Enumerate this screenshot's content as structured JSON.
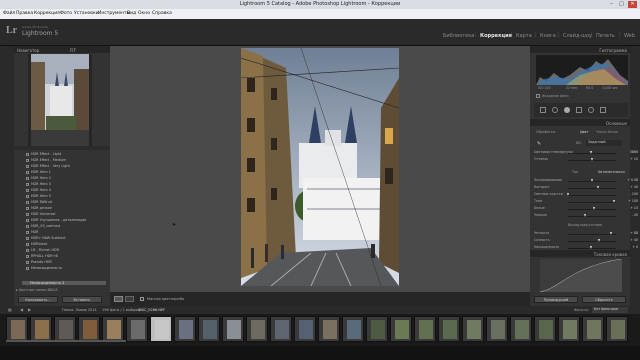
{
  "window": {
    "title": "Lightroom 5 Catalog - Adobe Photoshop Lightroom - Коррекции",
    "minimize": "–",
    "maximize": "□",
    "close": "✕"
  },
  "menu": [
    "Файл",
    "Правка",
    "Коррекция",
    "Фото",
    "Установки",
    "Инструменты",
    "Вид",
    "Окно",
    "Справка"
  ],
  "branding": {
    "logo": "Lr",
    "line1": "Adobe Photoshop",
    "line2": "Lightroom 5"
  },
  "modules": {
    "items": [
      "Библиотека",
      "Коррекция",
      "Карта",
      "Книга",
      "Слайд-шоу",
      "Печать",
      "Web"
    ],
    "active_index": 1
  },
  "left": {
    "navigator_title": "Навигатор",
    "navigator_zoom": "FIT",
    "presets": [
      "HDR Effect - Light",
      "HDR Effect - Medium",
      "HDR Effect - Very Light",
      "HDR Hero 1",
      "HDR Hero 2",
      "HDR Hero 3",
      "HDR Hero 4",
      "HDR Hero 5",
      "HDR RAW ok",
      "HDR резкое",
      "HDR Universal",
      "HDR Улучшение - детализация",
      "HDR_03_contrast",
      "HDR",
      "HDR+ RAW Subtract",
      "HDRblack",
      "LR - Filmish HDR",
      "RPHALL HDR+B",
      "Pseudo HDR",
      "Ненасыщенность"
    ],
    "selected_preset": "Ненасыщенность 2",
    "group": "Цветные линии BW2A",
    "copy_button": "Копировать...",
    "paste_button": "Вставить"
  },
  "toolbar": {
    "softproof": "Мягкая цветопроба"
  },
  "right": {
    "histogram_title": "Гистограмма",
    "photo_info": [
      "ISO 100",
      "22 mm",
      "f/5.0",
      "1/100 sec"
    ],
    "original_photo": "Исходное фото",
    "basic_title": "Основные",
    "treatment_label": "Обработка:",
    "color_option": "Цвет",
    "bw_option": "Черно-белое",
    "wb_label": "ББ:",
    "wb_value": "Заданный",
    "tone_label": "Тон",
    "auto_label": "Автоматически",
    "presence_label": "Выход присутствия",
    "sliders": [
      {
        "label": "Цветовая температура",
        "value": "5866",
        "pos": 0.5
      },
      {
        "label": "Оттенок",
        "value": "+ 10",
        "pos": 0.52
      },
      {
        "label": "Экспонирование",
        "value": "+ 0.06",
        "pos": 0.52
      },
      {
        "label": "Контраст",
        "value": "+ 40",
        "pos": 0.64
      },
      {
        "label": "Светлые участки",
        "value": "- 100",
        "pos": 0.02
      },
      {
        "label": "Тени",
        "value": "+ 100",
        "pos": 0.98
      },
      {
        "label": "Белые",
        "value": "+ 15",
        "pos": 0.56
      },
      {
        "label": "Черные",
        "value": "- 40",
        "pos": 0.36
      },
      {
        "label": "Четкость",
        "value": "+ 88",
        "pos": 0.9
      },
      {
        "label": "Сочность",
        "value": "+ 40",
        "pos": 0.66
      },
      {
        "label": "Насыщенность",
        "value": "+ 0",
        "pos": 0.5
      }
    ],
    "curve_title": "Тоновая кривая",
    "prev_button": "Предыдущий",
    "reset_button": "Сбросить"
  },
  "filmstrip": {
    "label": "Папка: Львов 2014",
    "count": "196 фото / 1 выбрано",
    "filename": "/DSC_0266.NEF",
    "filter_label": "Фильтр:",
    "filter_value": "Без фильтров",
    "thumbs": [
      "#7a6a55",
      "#8a6f4a",
      "#5f5a55",
      "#7f5d3b",
      "#9a7f5f",
      "#6b6b6b",
      "#c7c7c7",
      "#6a7080",
      "#54606a",
      "#8a8f95",
      "#6f6a60",
      "#5f6570",
      "#556070",
      "#7a7060",
      "#5a6a7a",
      "#4f5a45",
      "#6a7a55",
      "#607050",
      "#5a6a50",
      "#707a60",
      "#6a7060",
      "#65705a",
      "#5a6550",
      "#6f7a60",
      "#707560",
      "#6a6f58"
    ],
    "selected_index": 6
  },
  "colors": {
    "panel_bg": "#333333",
    "center_bg": "#4a4a4a",
    "active_module": "#e6e6e6"
  }
}
